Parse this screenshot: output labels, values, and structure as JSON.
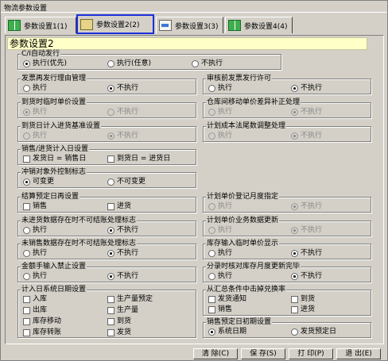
{
  "window": {
    "title": "物流参数设置"
  },
  "tabs": [
    {
      "label": "参数设置1(1)",
      "icon": "book-icon"
    },
    {
      "label": "参数设置2(2)",
      "icon": "scroll-icon"
    },
    {
      "label": "参数设置3(3)",
      "icon": "note-icon"
    },
    {
      "label": "参数设置4(4)",
      "icon": "book-icon"
    }
  ],
  "panel": {
    "header": "参数设置2"
  },
  "groups": {
    "ci_auto": {
      "title": "C/I自动发行",
      "options": [
        "执行(优先)",
        "执行(任意)",
        "不执行"
      ]
    },
    "invoice_reissue": {
      "title": "发票再发行理由管理",
      "options": [
        "执行",
        "不执行"
      ]
    },
    "audit_pre_invoice": {
      "title": "审核前发票发行许可",
      "options": [
        "执行",
        "不执行"
      ]
    },
    "unit_price_on_arrival": {
      "title": "到货时临时单价设置",
      "options": [
        "执行",
        "不执行"
      ]
    },
    "warehouse_transfer_diff": {
      "title": "仓库间移动单价差异补正处理",
      "options": [
        "执行",
        "不执行"
      ]
    },
    "arrival_day_basis": {
      "title": "到货日计入进货基准设置",
      "options": [
        "执行",
        "不执行"
      ]
    },
    "cost_rounding": {
      "title": "计划成本法尾数调整处理",
      "options": [
        "执行",
        "不执行"
      ]
    },
    "sales_purchase_date": {
      "title": "销售/进货计入日设置",
      "options": [
        "发货日 = 销售日",
        "到货日 = 进货日"
      ]
    },
    "offset_control": {
      "title": "冲销对象外控制标志",
      "options": [
        "可变更",
        "不可变更"
      ]
    },
    "settlement_date": {
      "title": "结算预定日再设置",
      "options": [
        "销售",
        "进货"
      ]
    },
    "plan_price_period": {
      "title": "计划单价登记月度指定",
      "options": [
        "执行",
        "不执行"
      ]
    },
    "unpurchased_flag": {
      "title": "未进货数据存在时不可结账处理标志",
      "options": [
        "执行",
        "不执行"
      ]
    },
    "plan_price_update": {
      "title": "计划单价业务数据更新",
      "options": [
        "执行",
        "不执行"
      ]
    },
    "unsold_flag": {
      "title": "未销售数据存在时不可结账处理标志",
      "options": [
        "执行",
        "不执行"
      ]
    },
    "stock_temp_price": {
      "title": "库存输入临时单价显示",
      "options": [
        "执行",
        "不执行"
      ]
    },
    "amount_manual_ban": {
      "title": "金额手输入禁止设置",
      "options": [
        "执行",
        "不执行"
      ]
    },
    "stock_month_update": {
      "title": "分录时核对库存月度更新完毕",
      "options": [
        "执行",
        "不执行"
      ]
    },
    "system_date_setting": {
      "title": "计入日系统日期设置",
      "options": [
        "入库",
        "生产量预定",
        "出库",
        "生产量",
        "库存移动",
        "到货",
        "库存转账",
        "发货"
      ]
    },
    "exchange_conversion": {
      "title": "从汇总条件中击掉兑换率",
      "options": [
        "发货通知",
        "到货",
        "销售",
        "进货"
      ]
    },
    "sales_plan_init": {
      "title": "销售预定日初期设置",
      "options": [
        "系统日期",
        "发货预定日"
      ]
    }
  },
  "buttons": {
    "clear": "清  除(C)",
    "save": "保  存(S)",
    "print": "打  印(P)",
    "exit": "退  出(E)"
  }
}
